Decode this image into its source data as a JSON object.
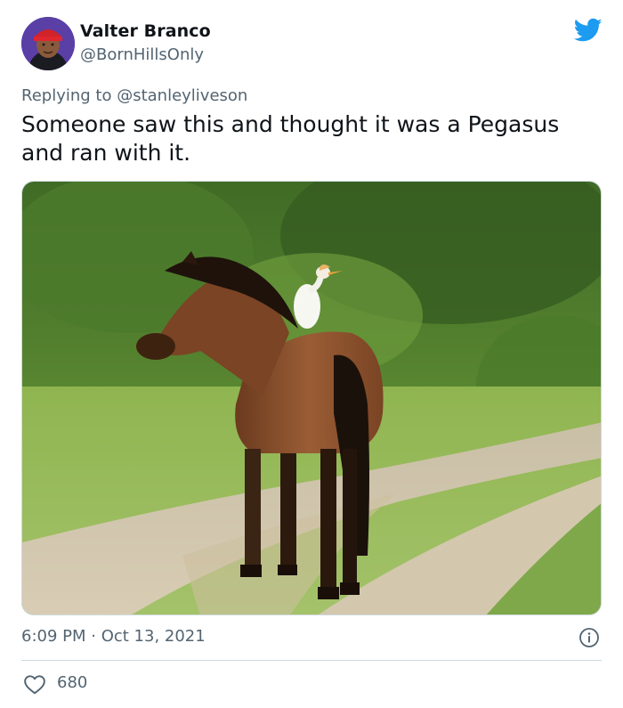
{
  "author": {
    "display_name": "Valter Branco",
    "handle": "@BornHillsOnly",
    "avatar_icon": "user-avatar"
  },
  "brand_icon": "twitter-bird-icon",
  "brand_color": "#1d9bf0",
  "reply": {
    "prefix": "Replying to ",
    "mention": "@stanleyliveson"
  },
  "tweet_text": "Someone saw this and thought it was a Pegasus and ran with it.",
  "media": {
    "description_icon": "photo",
    "content": "horse with egret on back on a dirt road"
  },
  "timestamp": "6:09 PM · Oct 13, 2021",
  "stats": {
    "likes": "680"
  },
  "colors": {
    "text_primary": "#0f1419",
    "text_secondary": "#536471",
    "border": "#cfd9de"
  }
}
